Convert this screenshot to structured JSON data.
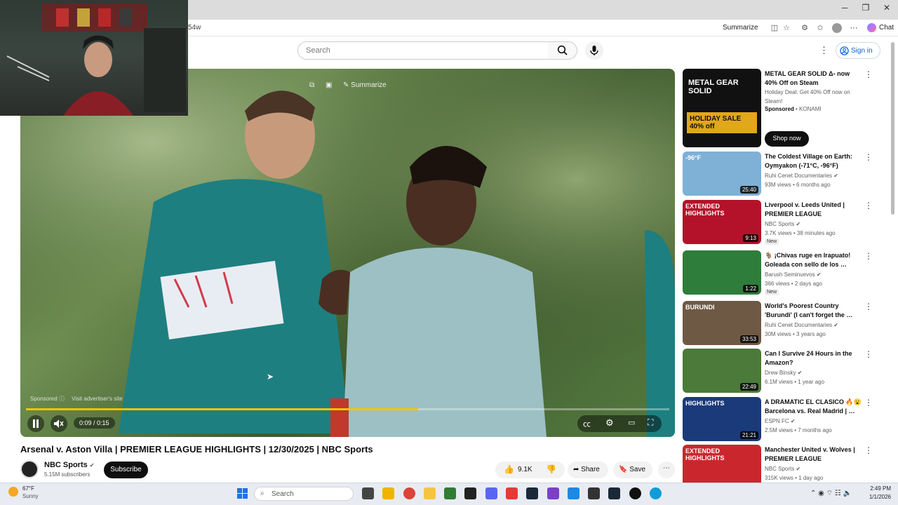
{
  "browser": {
    "url_fragment": "54w",
    "summarize_label": "Summarize",
    "chat_label": "Chat"
  },
  "header": {
    "search_placeholder": "Search",
    "signin_label": "Sign in"
  },
  "video": {
    "overlay_summarize": "Summarize",
    "sponsored_label": "Sponsored",
    "advertiser_link": "Visit advertiser's site",
    "time_display": "0:09 / 0:15",
    "progress": 0.61,
    "title": "Arsenal v. Aston Villa | PREMIER LEAGUE HIGHLIGHTS | 12/30/2025 | NBC Sports",
    "channel": "NBC Sports",
    "subscribers": "5.15M subscribers",
    "subscribe_label": "Subscribe",
    "likes": "9.1K",
    "share_label": "Share",
    "save_label": "Save"
  },
  "sidebar": {
    "ad": {
      "title": "METAL GEAR SOLID Δ- now 40% Off on Steam",
      "desc": "Holiday Deal: Get 40% Off now on Steam!",
      "sponsored": "Sponsored",
      "sponsor_name": "KONAMI",
      "cta": "Shop now",
      "thumb_text": "METAL GEAR SOLID",
      "thumb_sale": "HOLIDAY SALE 40% off"
    },
    "items": [
      {
        "title": "The Coldest Village on Earth: Oymyakon (-71°C, -96°F)",
        "channel": "Ruhi Cenet Documentaries",
        "meta": "93M views • 6 months ago",
        "duration": "25:40",
        "badge": "",
        "thumb_text": "-96°F"
      },
      {
        "title": "Liverpool v. Leeds United | PREMIER LEAGUE HIGHLIGHT…",
        "channel": "NBC Sports",
        "meta": "3.7K views • 38 minutes ago",
        "duration": "9:13",
        "badge": "New",
        "thumb_text": "EXTENDED HIGHLIGHTS"
      },
      {
        "title": "🐐 ¡Chivas ruge en Irapuato! Goleada con sello de los …",
        "channel": "Barush Seminuevos",
        "meta": "366 views • 2 days ago",
        "duration": "1:22",
        "badge": "New",
        "thumb_text": ""
      },
      {
        "title": "World's Poorest Country 'Burundi' (I can't forget the …",
        "channel": "Ruhi Cenet Documentaries",
        "meta": "30M views • 3 years ago",
        "duration": "33:53",
        "badge": "",
        "thumb_text": "BURUNDI"
      },
      {
        "title": "Can I Survive 24 Hours in the Amazon?",
        "channel": "Drew Binsky",
        "meta": "6.1M views • 1 year ago",
        "duration": "22:49",
        "badge": "",
        "thumb_text": ""
      },
      {
        "title": "A DRAMATIC EL CLASICO 🔥😮 Barcelona vs. Real Madrid | …",
        "channel": "ESPN FC",
        "meta": "2.5M views • 7 months ago",
        "duration": "21:21",
        "badge": "",
        "thumb_text": "HIGHLIGHTS"
      },
      {
        "title": "Manchester United v. Wolves | PREMIER LEAGUE HIGHLIGHT…",
        "channel": "NBC Sports",
        "meta": "315K views • 1 day ago",
        "duration": "",
        "badge": "",
        "thumb_text": "EXTENDED HIGHLIGHTS"
      }
    ]
  },
  "taskbar": {
    "weather_temp": "67°F",
    "weather_desc": "Sunny",
    "search_label": "Search",
    "time": "2:49 PM",
    "date": "1/1/2026"
  },
  "colors": {
    "progress": "#f4c400",
    "link_blue": "#065fd4"
  }
}
